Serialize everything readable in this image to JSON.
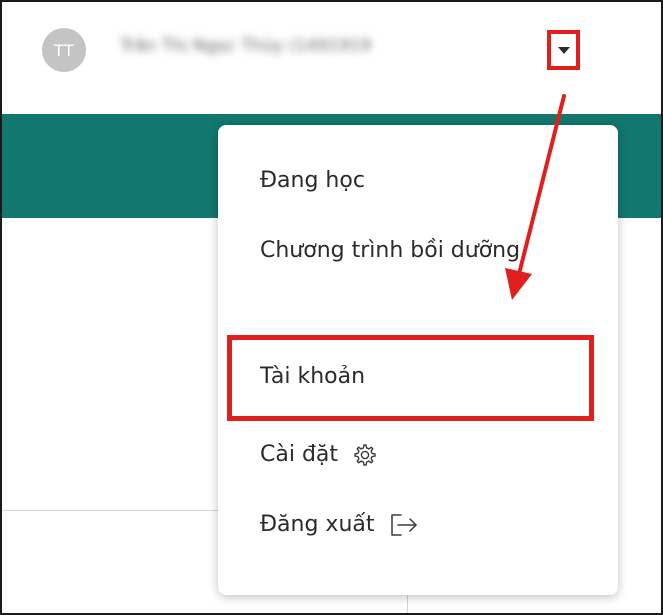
{
  "header": {
    "avatar_initials": "TT",
    "username": "Trần Thị Ngọc Thủy (1491919"
  },
  "menu": {
    "items": [
      {
        "label": "Đang học"
      },
      {
        "label": "Chương trình bồi dưỡng"
      },
      {
        "label": "Tài khoản"
      },
      {
        "label": "Cài đặt",
        "icon": "gear-icon"
      },
      {
        "label": "Đăng xuất",
        "icon": "logout-icon"
      }
    ]
  },
  "colors": {
    "teal_band": "#12776e",
    "annotation_red": "#e0201d",
    "avatar_bg": "#c4c4c4"
  }
}
